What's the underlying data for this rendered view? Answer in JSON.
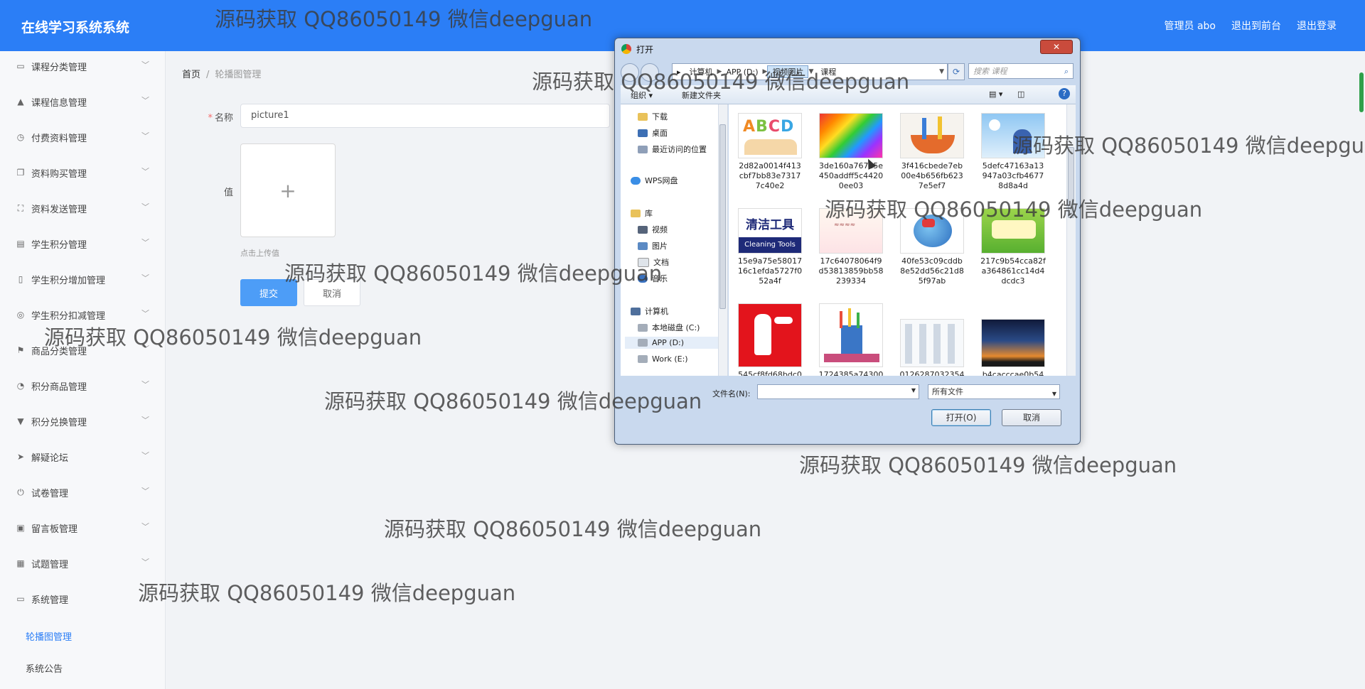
{
  "header": {
    "brand": "在线学习系统系统",
    "links": [
      "管理员 abo",
      "退出到前台",
      "退出登录"
    ]
  },
  "sidebar": {
    "items": [
      {
        "label": "课程分类管理",
        "icon": "chat-icon"
      },
      {
        "label": "课程信息管理",
        "icon": "thumb-icon"
      },
      {
        "label": "付费资料管理",
        "icon": "clock-icon"
      },
      {
        "label": "资料购买管理",
        "icon": "copy-icon"
      },
      {
        "label": "资料发送管理",
        "icon": "fullscreen-icon"
      },
      {
        "label": "学生积分管理",
        "icon": "monitor-icon"
      },
      {
        "label": "学生积分增加管理",
        "icon": "mic-icon"
      },
      {
        "label": "学生积分扣减管理",
        "icon": "globe-icon"
      },
      {
        "label": "商品分类管理",
        "icon": "flag-icon"
      },
      {
        "label": "积分商品管理",
        "icon": "compass-icon"
      },
      {
        "label": "积分兑换管理",
        "icon": "thumb-down-icon"
      },
      {
        "label": "解疑论坛",
        "icon": "send-icon"
      },
      {
        "label": "试卷管理",
        "icon": "power-icon"
      },
      {
        "label": "留言板管理",
        "icon": "clipboard-icon"
      },
      {
        "label": "试题管理",
        "icon": "grid-icon"
      },
      {
        "label": "系统管理",
        "icon": "message-icon"
      }
    ],
    "sub_items": [
      "轮播图管理",
      "系统公告"
    ]
  },
  "breadcrumb": {
    "home": "首页",
    "separator": "/",
    "current": "轮播图管理"
  },
  "form": {
    "name_label": "名称",
    "required_mark": "*",
    "name_value": "picture1",
    "value_label": "值",
    "upload_plus": "+",
    "upload_tip": "点击上传值",
    "submit": "提交",
    "cancel": "取消"
  },
  "dialog": {
    "title": "打开",
    "close": "✕",
    "address": [
      "计算机",
      "APP (D:)",
      "视频图片",
      "课程"
    ],
    "search_placeholder": "搜索 课程",
    "toolbar": {
      "organize": "组织 ▾",
      "new_folder": "新建文件夹",
      "help": "?"
    },
    "nav": [
      {
        "label": "下载",
        "group": "fav"
      },
      {
        "label": "桌面",
        "group": "fav"
      },
      {
        "label": "最近访问的位置",
        "group": "fav"
      },
      {
        "label": "WPS网盘",
        "group": "cloud"
      },
      {
        "label": "库",
        "group": "lib-head"
      },
      {
        "label": "视频",
        "group": "lib"
      },
      {
        "label": "图片",
        "group": "lib"
      },
      {
        "label": "文档",
        "group": "lib"
      },
      {
        "label": "音乐",
        "group": "lib"
      },
      {
        "label": "计算机",
        "group": "pc-head"
      },
      {
        "label": "本地磁盘 (C:)",
        "group": "pc"
      },
      {
        "label": "APP (D:)",
        "group": "pc"
      },
      {
        "label": "Work (E:)",
        "group": "pc"
      }
    ],
    "files": [
      {
        "name": "2d82a0014f413cbf7bb83e73177c40e2",
        "thumb": "abcd-kids"
      },
      {
        "name": "3de160a767e5e450addff5c44200ee03",
        "thumb": "color-pencils"
      },
      {
        "name": "3f416cbede7eb00e4b656fb6237e5ef7",
        "thumb": "cleaning-bucket"
      },
      {
        "name": "5defc47163a13947a03cfb46778d8a4d",
        "thumb": "child-reading"
      },
      {
        "name": "15e9a75e5801716c1efda5727f052a4f",
        "thumb": "cleaning-tools-sign"
      },
      {
        "name": "17c64078064f9d53813859bb58239334",
        "thumb": "word-review"
      },
      {
        "name": "40fe53c09cddb8e52dd56c21d85f97ab",
        "thumb": "cartoon-globe"
      },
      {
        "name": "217c9b54cca82fa364861cc14d4dcdc3",
        "thumb": "chinese-garden"
      },
      {
        "name": "545cf8fd68bdc0",
        "thumb": "fire-extinguisher"
      },
      {
        "name": "1724385a74300",
        "thumb": "pencil-cup"
      },
      {
        "name": "0126287032354",
        "thumb": "tools-grid"
      },
      {
        "name": "b4cacccae0b54",
        "thumb": "sunset"
      }
    ],
    "clean_tools_cn": "清洁工具",
    "clean_tools_en": "Cleaning Tools",
    "file_name_label": "文件名(N):",
    "file_name_value": "",
    "file_type": "所有文件",
    "open": "打开(O)",
    "cancel": "取消"
  },
  "watermark": "源码获取 QQ86050149 微信deepguan"
}
